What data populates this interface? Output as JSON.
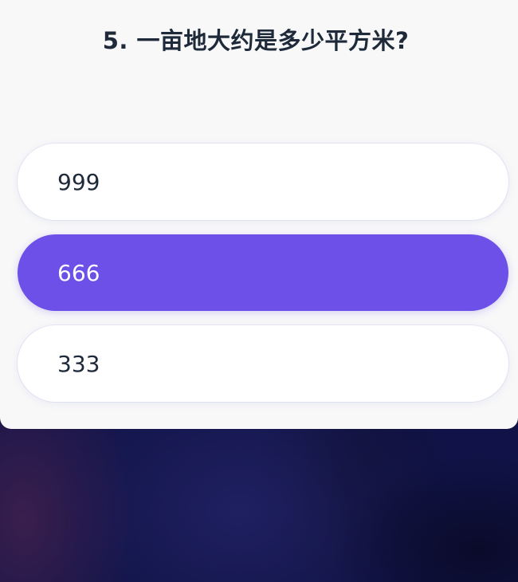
{
  "quiz": {
    "question": "5. 一亩地大约是多少平方米?",
    "options": [
      {
        "label": "999",
        "selected": false
      },
      {
        "label": "666",
        "selected": true
      },
      {
        "label": "333",
        "selected": false
      }
    ]
  },
  "colors": {
    "card_background": "#f8f8f9",
    "option_background": "#ffffff",
    "selected_accent": "#6c50e8",
    "text_dark": "#1e2a3a",
    "backdrop": "#14164a"
  }
}
